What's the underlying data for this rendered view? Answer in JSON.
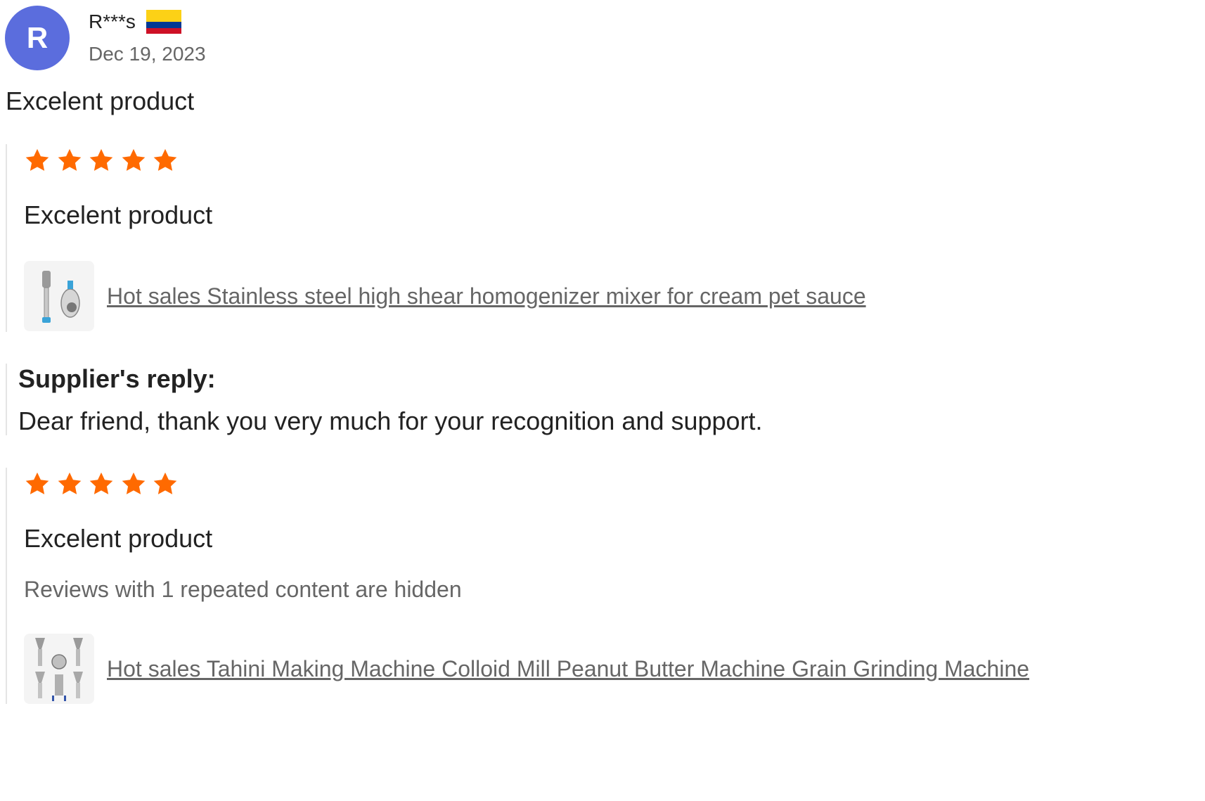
{
  "reviewer": {
    "avatar_initial": "R",
    "name": "R***s",
    "country_flag_icon": "colombia-flag-icon",
    "date": "Dec 19, 2023",
    "avatar_color": "#5b6ddd"
  },
  "review_title": "Excelent product",
  "first_review": {
    "rating": 5,
    "rating_max": 5,
    "text": "Excelent product",
    "product_link": "Hot sales Stainless steel high shear homogenizer mixer for cream pet sauce",
    "product_icon": "homogenizer-mixer-thumbnail"
  },
  "supplier_reply": {
    "heading": "Supplier's reply:",
    "text": "Dear friend, thank you very much for your recognition and support."
  },
  "second_review": {
    "rating": 5,
    "rating_max": 5,
    "text": "Excelent product",
    "hidden_note": "Reviews with 1 repeated content are hidden",
    "product_link": "Hot sales Tahini Making Machine Colloid Mill Peanut Butter Machine Grain Grinding Machine",
    "product_icon": "colloid-mill-thumbnail"
  },
  "colors": {
    "star": "#ff6a00",
    "link": "#666666",
    "flag_yellow": "#fcd116",
    "flag_blue": "#003893",
    "flag_red": "#ce1126"
  }
}
